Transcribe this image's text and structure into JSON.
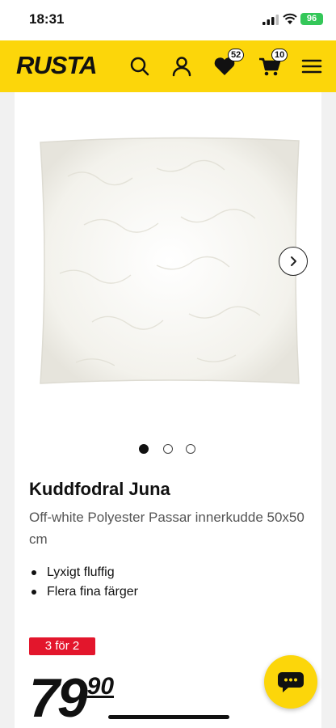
{
  "status_bar": {
    "time": "18:31",
    "battery": "96"
  },
  "header": {
    "logo": "RUSTA",
    "favorites_count": "52",
    "cart_count": "10",
    "brand_color": "#fcd60a"
  },
  "gallery": {
    "image_icon": "cushion-cover-image",
    "next_icon": "chevron-right-icon",
    "slide_count": 3,
    "active_slide": 1
  },
  "product": {
    "title": "Kuddfodral Juna",
    "description": "Off-white Polyester Passar innerkudde 50x50 cm",
    "features": [
      "Lyxigt fluffig",
      "Flera fina färger"
    ],
    "promo": "3 för 2",
    "price_integer": "79",
    "price_decimal": "90",
    "promo_color": "#e3162c"
  },
  "chat": {
    "icon": "chat-bubble-icon"
  }
}
